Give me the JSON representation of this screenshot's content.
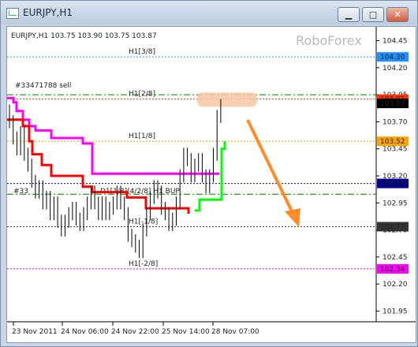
{
  "window": {
    "title": "EURJPY,H1",
    "buttons": {
      "minimize": "▁",
      "maximize": "□",
      "close": "✕"
    }
  },
  "chart_data": {
    "type": "line",
    "symbol_header": "EURJPY,H1  103.75 103.90 103.75 103.87",
    "watermark": "RoboForex",
    "trade_label": "#33471788 sell",
    "trade_label_2": "#33",
    "ylim": [
      101.88,
      104.52
    ],
    "y_ticks": [
      "104.45",
      "104.20",
      "103.95",
      "103.70",
      "103.45",
      "103.20",
      "102.95",
      "102.70",
      "102.45",
      "102.20",
      "101.95"
    ],
    "x_ticks": [
      "23 Nov 2011",
      "24 Nov 06:00",
      "24 Nov 22:00",
      "25 Nov 14:00",
      "28 Nov 07:00"
    ],
    "current_price": "103.87",
    "levels": [
      {
        "label": "H1[3/8]",
        "value": 104.3,
        "color": "#1e90ff",
        "tag": "104.30"
      },
      {
        "label": "H1[2/8]",
        "value": 103.91,
        "color": "#ff3300",
        "tag": "103.91"
      },
      {
        "label": "H1[1/8]",
        "value": 103.52,
        "color": "#ffa500",
        "tag": "103.52"
      },
      {
        "label": "",
        "value": 103.13,
        "color": "#00008b",
        "tag": "103.13"
      },
      {
        "label": "H1[-1/8]",
        "value": 102.73,
        "color": "#333333",
        "tag": "102.73"
      },
      {
        "label": "H1[-2/8]",
        "value": 102.34,
        "color": "#ff00ff",
        "tag": "102.34"
      }
    ],
    "green_lines": [
      103.95,
      103.03
    ],
    "mid_label": "D1[1/8](4/2/8] H1 BUP",
    "colors": {
      "magenta": "#ff00ff",
      "red": "#ff0000",
      "green": "#00ff00",
      "arrow": "#ff8c28",
      "highlight": "#f7c7a3",
      "bars": "#000000"
    }
  }
}
